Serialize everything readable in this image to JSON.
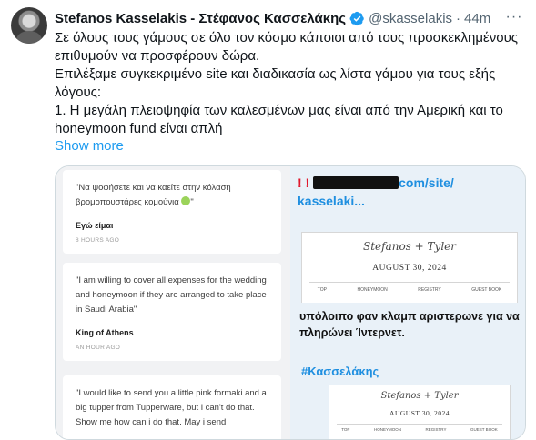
{
  "tweet": {
    "author_name": "Stefanos Kasselakis - Στέφανος Κασσελάκης",
    "handle": "@skasselakis",
    "separator": "·",
    "time": "44m",
    "text_lines": [
      "Σε όλους τους γάμους σε όλο τον κόσμο κάποιοι από τους προσκεκλημένους επιθυμούν να προσφέρουν δώρα.",
      "Επιλέξαμε συγκεκριμένο site και διαδικασία ως λίστα γάμου για τους εξής λόγους:",
      "1. Η μεγάλη πλειοψηφία των καλεσμένων μας είναι από την Αμερική και το honeymoon fund είναι απλή"
    ],
    "show_more": "Show more",
    "more_icon": "ellipsis-icon",
    "verified_color": "#1d9bf0"
  },
  "image": {
    "comments": [
      {
        "text": "\"Να ψοφήσετε και να καείτε στην κόλαση βρομοπουστάρες κομούνια",
        "text_end": "\"",
        "author": "Εγώ είμαι",
        "time": "8 HOURS AGO"
      },
      {
        "text": "\"I am willing to cover all expenses for the wedding and honeymoon if they are arranged to take place in Saudi Arabia\"",
        "author": "King of Athens",
        "time": "AN HOUR AGO"
      },
      {
        "text": "\"I would like to send you a little pink formaki and a big tupper from Tupperware, but i can't do that. Show me how can i do that. May i send",
        "author": "",
        "time": ""
      }
    ],
    "url_prefix": "! !",
    "url_suffix": "com/site/",
    "url_line2": "kasselaki...",
    "site": {
      "names": "Stefanos + Tyler",
      "date": "AUGUST 30, 2024",
      "nav": [
        "TOP",
        "HONEYMOON",
        "REGISTRY",
        "GUEST BOOK"
      ]
    },
    "caption": "υπόλοιπο φαν κλαμπ αριστερωνε για να πληρώνει Ίντερνετ.",
    "hashtag": "#Κασσελάκης",
    "site2": {
      "names": "Stefanos + Tyler",
      "date": "AUGUST 30, 2024",
      "nav": [
        "TOP",
        "HONEYMOON",
        "REGISTRY",
        "GUEST BOOK"
      ]
    }
  }
}
